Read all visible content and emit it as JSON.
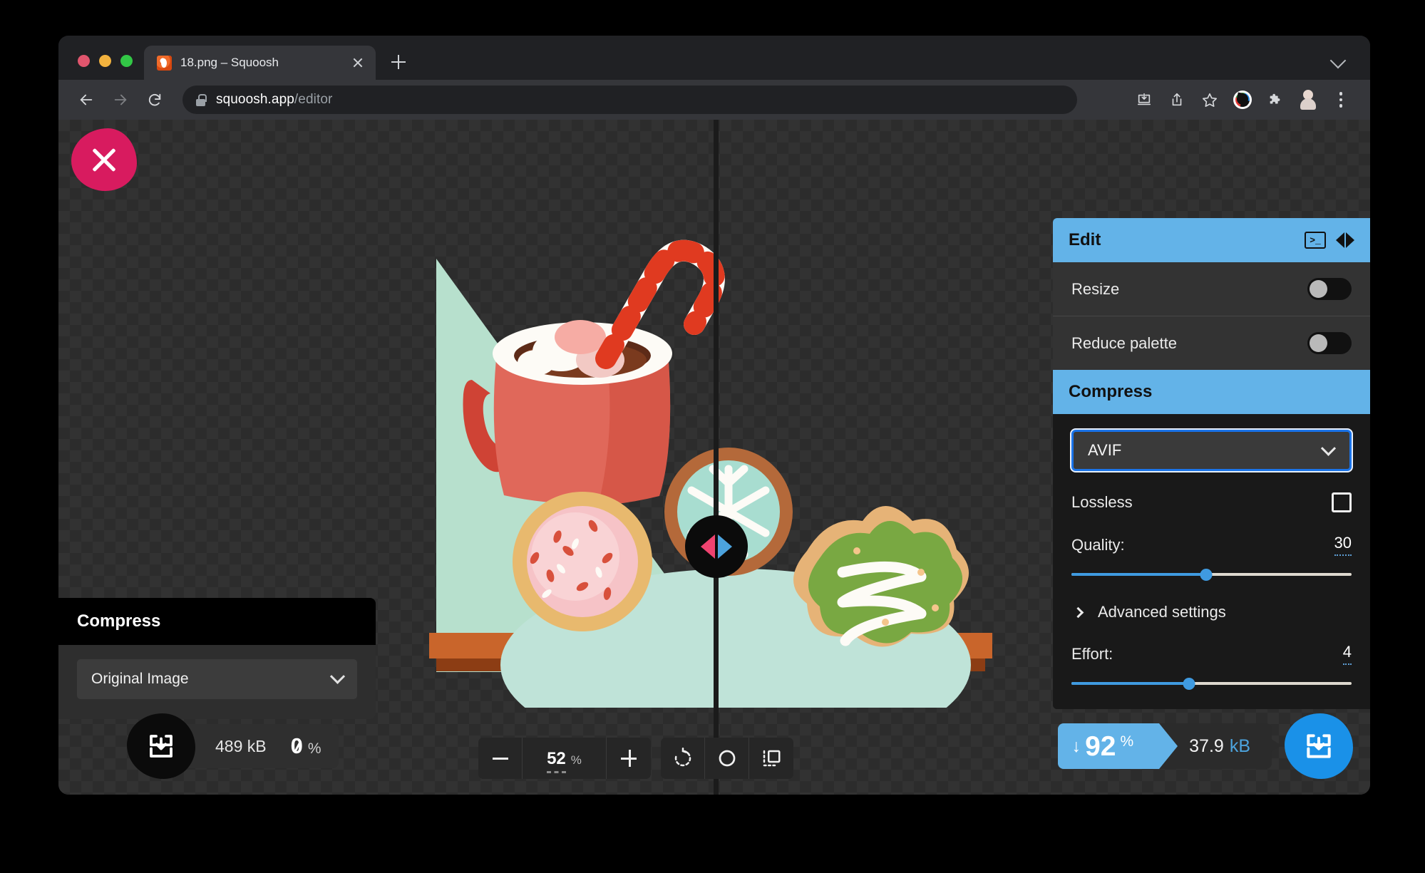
{
  "browser": {
    "tab": {
      "title": "18.png – Squoosh",
      "favicon": "squoosh-favicon-icon",
      "close": "close-tab-icon"
    },
    "new_tab_label": "+",
    "nav": {
      "back": "back-arrow-icon",
      "forward": "forward-arrow-icon",
      "reload": "reload-icon"
    },
    "omnibox": {
      "lock": "lock-icon",
      "domain": "squoosh.app",
      "path": "/editor"
    },
    "toolbar_icons": [
      "install-app-icon",
      "share-icon",
      "bookmark-star-icon",
      "extension-color-icon",
      "extensions-puzzle-icon",
      "profile-avatar-icon",
      "more-menu-icon"
    ]
  },
  "canvas": {
    "close_button": "close-image-icon",
    "comparison_handle": "compare-slider-handle"
  },
  "left_panel": {
    "header": "Compress",
    "select_value": "Original Image",
    "download_icon": "download-icon",
    "size": "489 kB",
    "percent": "0",
    "percent_symbol": "%"
  },
  "zoom_controls": {
    "minus": "−",
    "value": "52",
    "unit": "%",
    "plus": "+",
    "rotate": "rotate-icon",
    "background": "toggle-background-icon",
    "fit": "fit-to-screen-icon"
  },
  "right_panel": {
    "edit": {
      "title": "Edit",
      "terminal_icon": ">_",
      "arrows_icon": "prev-next-arrows-icon",
      "rows": [
        {
          "label": "Resize",
          "toggle": "off"
        },
        {
          "label": "Reduce palette",
          "toggle": "off"
        }
      ]
    },
    "compress": {
      "title": "Compress",
      "format": "AVIF",
      "lossless_label": "Lossless",
      "lossless_checked": false,
      "quality_label": "Quality:",
      "quality_value": "30",
      "quality_percent": 48,
      "advanced_label": "Advanced settings",
      "effort_label": "Effort:",
      "effort_value": "4",
      "effort_percent": 42
    }
  },
  "result": {
    "arrow": "↓",
    "percent": "92",
    "percent_symbol": "%",
    "size_number": "37.9",
    "size_unit": "kB",
    "download_icon": "download-icon"
  },
  "colors": {
    "accent_blue": "#63b3e8",
    "download_blue": "#1a91e8",
    "close_pink": "#d81b5f",
    "slider_blue": "#3f9ae0"
  }
}
